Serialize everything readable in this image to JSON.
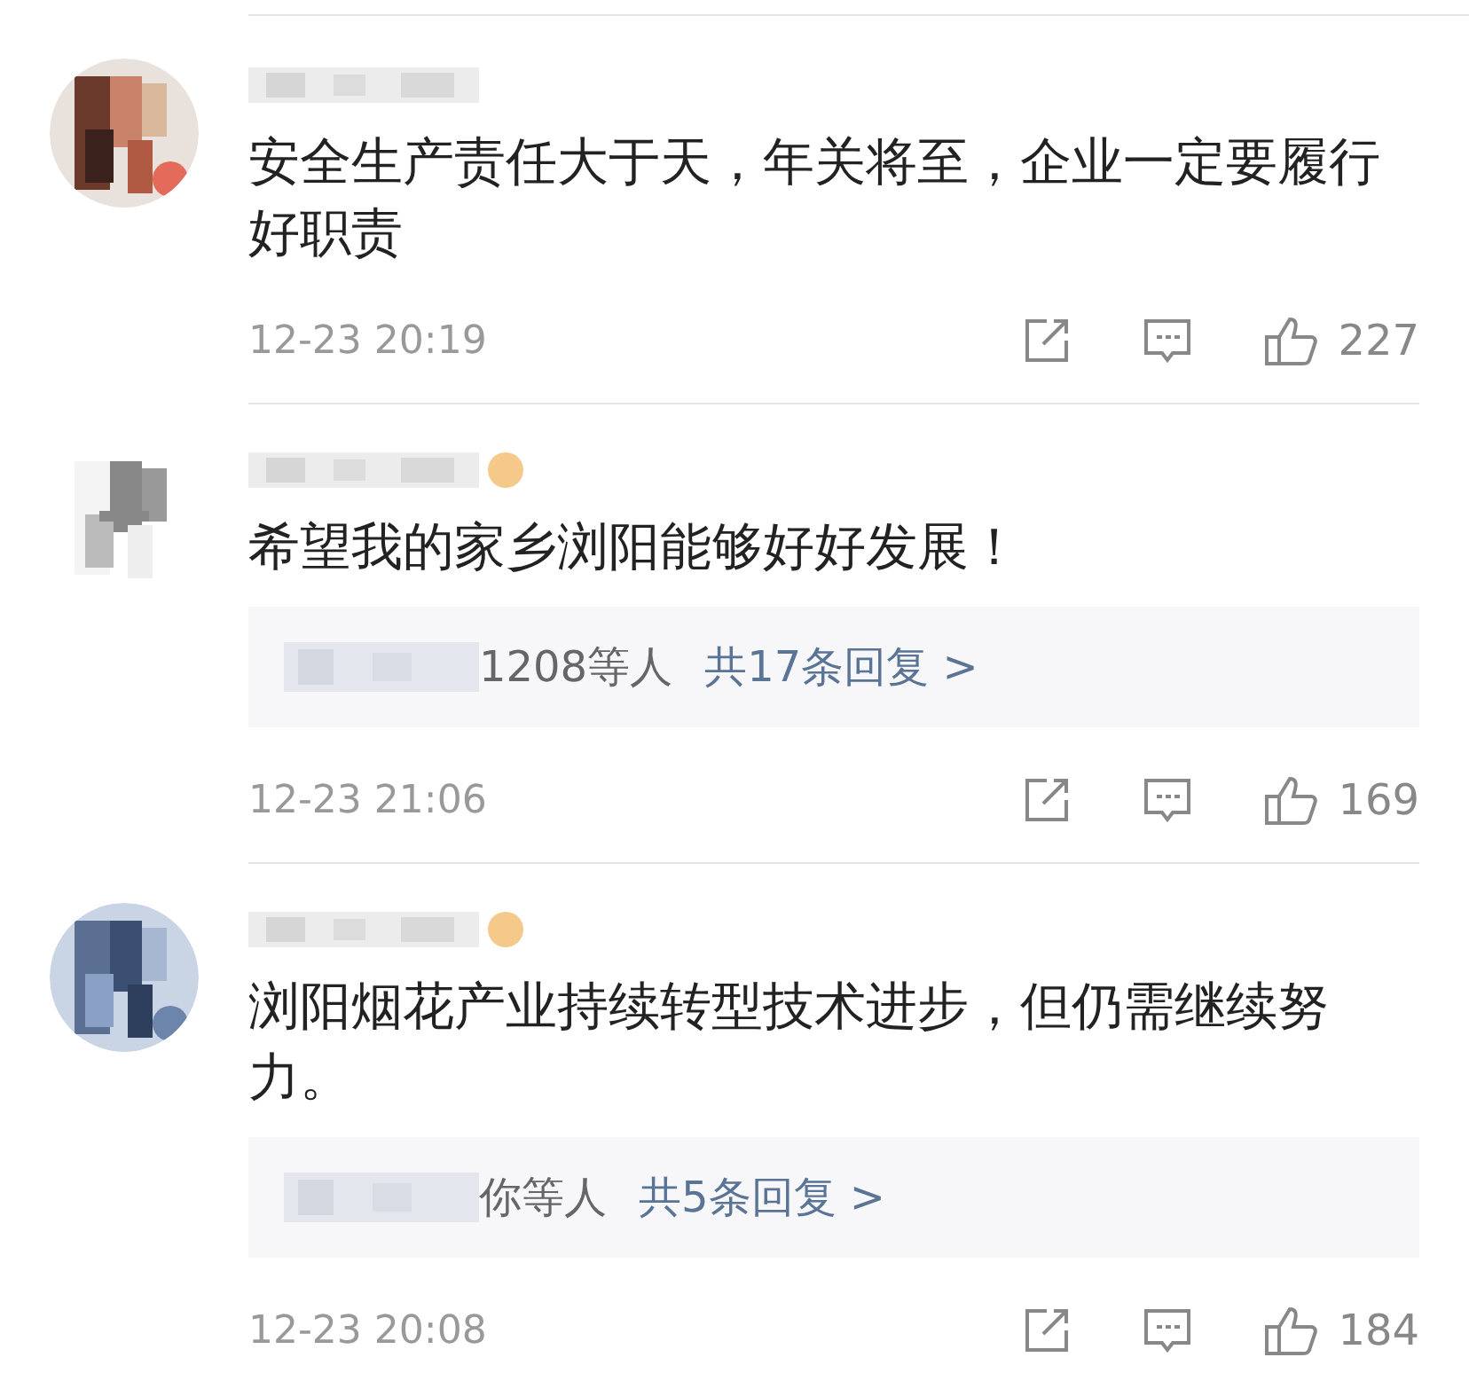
{
  "comments": [
    {
      "text": "安全生产责任大于天，年关将至，企业一定要履行好职责",
      "time": "12-23 20:19",
      "likes": "227",
      "badge": false
    },
    {
      "text": "希望我的家乡浏阳能够好好发展！",
      "time": "12-23 21:06",
      "likes": "169",
      "badge": true,
      "replies": {
        "who": "1208等人",
        "count": "共17条回复 >"
      }
    },
    {
      "text": "浏阳烟花产业持续转型技术进步，但仍需继续努力。",
      "time": "12-23 20:08",
      "likes": "184",
      "badge": true,
      "replies": {
        "who": "你等人",
        "count": "共5条回复 >"
      }
    }
  ]
}
